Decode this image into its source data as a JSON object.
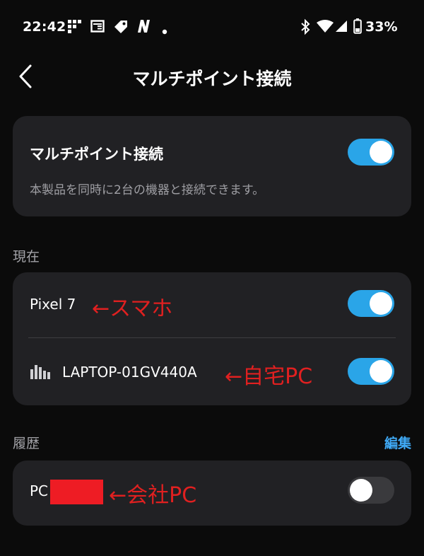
{
  "status_bar": {
    "time": "22:42",
    "notification_icons": [
      "grid-app-icon",
      "news-icon",
      "label-icon",
      "n-app-icon",
      "dot-icon"
    ],
    "right_icons": [
      "bluetooth-icon",
      "wifi-icon",
      "signal-icon",
      "battery-icon"
    ],
    "battery": "33%"
  },
  "header": {
    "title": "マルチポイント接続"
  },
  "multipoint": {
    "title": "マルチポイント接続",
    "description": "本製品を同時に2台の機器と接続できます。",
    "enabled": true
  },
  "current": {
    "label": "現在",
    "devices": [
      {
        "name": "Pixel 7",
        "annotation": "←スマホ",
        "connected": true
      },
      {
        "name": "LAPTOP-01GV440A",
        "annotation": "←自宅PC",
        "connected": true,
        "icon": "audio-bars-icon"
      }
    ]
  },
  "history": {
    "label": "履歴",
    "edit_label": "編集",
    "devices": [
      {
        "name": "PC",
        "annotation": "←会社PC",
        "connected": false
      }
    ]
  },
  "colors": {
    "accent": "#2aa5e8",
    "link": "#3fa9f5",
    "annotation": "#e02020",
    "card": "#212124",
    "background": "#0b0b0b"
  }
}
